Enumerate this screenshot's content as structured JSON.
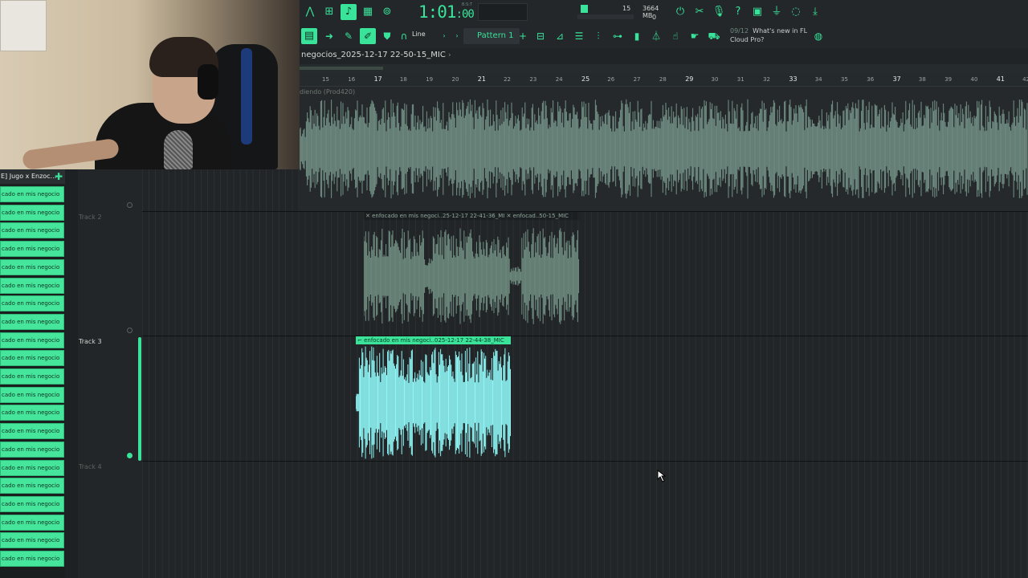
{
  "toolbar": {
    "time_main": "1:01",
    "time_sub": ":00",
    "time_label": "B:S:T",
    "cpu_value": "15",
    "memory": "3664 MB",
    "poly": "0",
    "snap_mode": "Line",
    "pattern": "Pattern 1",
    "news_date": "09/12",
    "news_text": "What's new in FL",
    "news_text2": "Cloud Pro?",
    "accent_color": "#39e39a"
  },
  "playlist": {
    "title": "negocios_2025-12-17 22-50-15_MIC",
    "ruler_ticks": [
      "15",
      "16",
      "17",
      "18",
      "19",
      "20",
      "21",
      "22",
      "23",
      "24",
      "25",
      "26",
      "27",
      "28",
      "29",
      "30",
      "31",
      "32",
      "33",
      "34",
      "35",
      "36",
      "37",
      "38",
      "39",
      "40",
      "41",
      "42"
    ],
    "top_clip_label": "diendo (Prod420)"
  },
  "channels": {
    "header": "E] Jugo x Enzoc...",
    "items": [
      "cado en mis negocio",
      "cado en mis negocio",
      "cado en mis negocio",
      "cado en mis negocio",
      "cado en mis negocio",
      "cado en mis negocio",
      "cado en mis negocio",
      "cado en mis negocio",
      "cado en mis negocio",
      "cado en mis negocio",
      "cado en mis negocio",
      "cado en mis negocio",
      "cado en mis negocio",
      "cado en mis negocio",
      "cado en mis negocio",
      "cado en mis negocio",
      "cado en mis negocio",
      "cado en mis negocio",
      "cado en mis negocio",
      "cado en mis negocio",
      "cado en mis negocio"
    ]
  },
  "tracks": [
    {
      "name": "Track 2"
    },
    {
      "name": "Track 3"
    },
    {
      "name": "Track 4"
    }
  ],
  "clips": {
    "track2_label": "enfocado en mis negoci..25-12-17 22-41-36_MI",
    "track2_label_b": "enfocad..50-15_MIC",
    "track3_label": "enfocado en mis negoci..025-12-17 22-44-38_MIC"
  }
}
